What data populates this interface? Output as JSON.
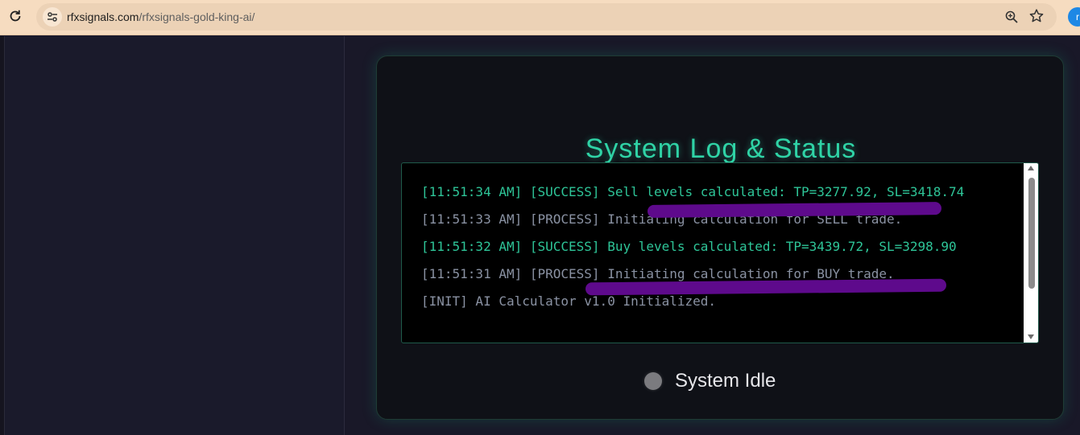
{
  "browser": {
    "url_host": "rfxsignals.com",
    "url_path": "/rfxsignals-gold-king-ai/",
    "profile_initial": "r"
  },
  "card": {
    "title": "System Log & Status"
  },
  "log": {
    "lines": [
      {
        "text": "[11:51:34 AM] [SUCCESS] Sell levels calculated: TP=3277.92, SL=3418.74",
        "kind": "success"
      },
      {
        "text": "[11:51:33 AM] [PROCESS] Initiating calculation for SELL trade.",
        "kind": "process"
      },
      {
        "text": "[11:51:32 AM] [SUCCESS] Buy levels calculated: TP=3439.72, SL=3298.90",
        "kind": "success"
      },
      {
        "text": "[11:51:31 AM] [PROCESS] Initiating calculation for BUY trade.",
        "kind": "process"
      },
      {
        "text": "[INIT] AI Calculator v1.0 Initialized.",
        "kind": "init"
      }
    ]
  },
  "status": {
    "label": "System Idle"
  },
  "colors": {
    "accent": "#2fd3a6",
    "success_text": "#2ec598",
    "process_text": "#8a92a3",
    "redaction": "#5e0a8c",
    "status_dot": "#7b7b7f"
  }
}
